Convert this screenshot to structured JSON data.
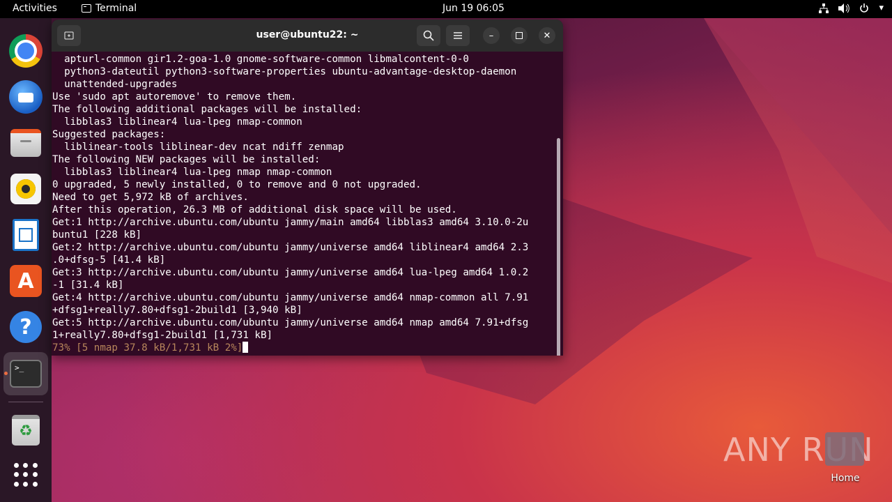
{
  "topbar": {
    "activities": "Activities",
    "app_name": "Terminal",
    "clock": "Jun 19  06:05"
  },
  "dock": {
    "items": [
      "chrome",
      "thunderbird",
      "files",
      "rhythmbox",
      "libreoffice-writer",
      "app-center",
      "help",
      "terminal",
      "trash",
      "show-apps"
    ]
  },
  "terminal": {
    "title": "user@ubuntu22: ~",
    "lines": [
      "  apturl-common gir1.2-goa-1.0 gnome-software-common libmalcontent-0-0",
      "  python3-dateutil python3-software-properties ubuntu-advantage-desktop-daemon",
      "  unattended-upgrades",
      "Use 'sudo apt autoremove' to remove them.",
      "The following additional packages will be installed:",
      "  libblas3 liblinear4 lua-lpeg nmap-common",
      "Suggested packages:",
      "  liblinear-tools liblinear-dev ncat ndiff zenmap",
      "The following NEW packages will be installed:",
      "  libblas3 liblinear4 lua-lpeg nmap nmap-common",
      "0 upgraded, 5 newly installed, 0 to remove and 0 not upgraded.",
      "Need to get 5,972 kB of archives.",
      "After this operation, 26.3 MB of additional disk space will be used.",
      "Get:1 http://archive.ubuntu.com/ubuntu jammy/main amd64 libblas3 amd64 3.10.0-2u",
      "buntu1 [228 kB]",
      "Get:2 http://archive.ubuntu.com/ubuntu jammy/universe amd64 liblinear4 amd64 2.3",
      ".0+dfsg-5 [41.4 kB]",
      "Get:3 http://archive.ubuntu.com/ubuntu jammy/universe amd64 lua-lpeg amd64 1.0.2",
      "-1 [31.4 kB]",
      "Get:4 http://archive.ubuntu.com/ubuntu jammy/universe amd64 nmap-common all 7.91",
      "+dfsg1+really7.80+dfsg1-2build1 [3,940 kB]",
      "Get:5 http://archive.ubuntu.com/ubuntu jammy/universe amd64 nmap amd64 7.91+dfsg",
      "1+really7.80+dfsg1-2build1 [1,731 kB]"
    ],
    "progress_line": "73% [5 nmap 37.8 kB/1,731 kB 2%]",
    "progress_color": "#b8865b"
  },
  "desktop": {
    "home_label": "Home",
    "watermark": "ANY RUN"
  }
}
